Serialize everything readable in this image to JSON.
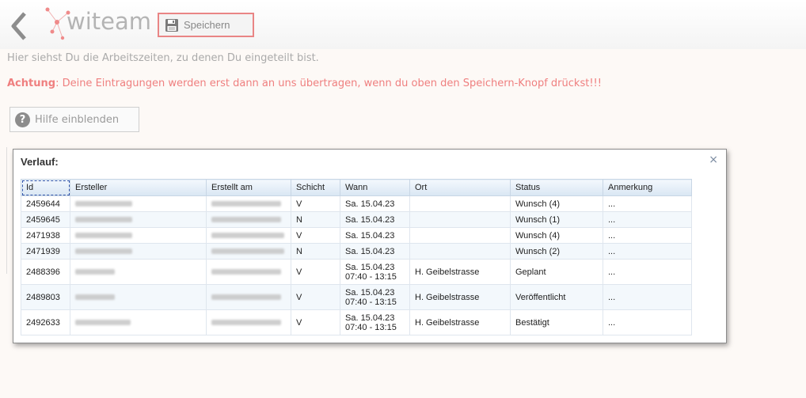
{
  "header": {
    "logo_text": "witeam",
    "save_label": "Speichern"
  },
  "info_text": "Hier siehst Du die Arbeitszeiten, zu denen Du eingeteilt bist.",
  "warning": {
    "prefix": "Achtung",
    "text": ": Deine Eintragungen werden erst dann an uns übertragen, wenn du oben den Speichern-Knopf drückst!!!"
  },
  "help_label": "Hilfe einblenden",
  "dialog": {
    "title": "Verlauf:",
    "close": "×",
    "columns": [
      "Id",
      "Ersteller",
      "Erstellt am",
      "Schicht",
      "Wann",
      "Ort",
      "Status",
      "Anmerkung"
    ],
    "rows": [
      {
        "id": "2459644",
        "schicht": "V",
        "wann1": "Sa. 15.04.23",
        "wann2": "",
        "ort": "",
        "status": "Wunsch (4)",
        "anmerkung": "..."
      },
      {
        "id": "2459645",
        "schicht": "N",
        "wann1": "Sa. 15.04.23",
        "wann2": "",
        "ort": "",
        "status": "Wunsch (1)",
        "anmerkung": "..."
      },
      {
        "id": "2471938",
        "schicht": "V",
        "wann1": "Sa. 15.04.23",
        "wann2": "",
        "ort": "",
        "status": "Wunsch (4)",
        "anmerkung": "..."
      },
      {
        "id": "2471939",
        "schicht": "N",
        "wann1": "Sa. 15.04.23",
        "wann2": "",
        "ort": "",
        "status": "Wunsch (2)",
        "anmerkung": "..."
      },
      {
        "id": "2488396",
        "schicht": "V",
        "wann1": "Sa. 15.04.23",
        "wann2": "07:40 - 13:15",
        "ort": "H. Geibelstrasse",
        "status": "Geplant",
        "anmerkung": "..."
      },
      {
        "id": "2489803",
        "schicht": "V",
        "wann1": "Sa. 15.04.23",
        "wann2": "07:40 - 13:15",
        "ort": "H. Geibelstrasse",
        "status": "Veröffentlicht",
        "anmerkung": "..."
      },
      {
        "id": "2492633",
        "schicht": "V",
        "wann1": "Sa. 15.04.23",
        "wann2": "07:40 - 13:15",
        "ort": "H. Geibelstrasse",
        "status": "Bestätigt",
        "anmerkung": "..."
      }
    ]
  },
  "colors": {
    "accent": "#e98585",
    "warning_text": "#ef7f7f",
    "muted_text": "#aaaaaa",
    "table_header": "#d9e6f3"
  }
}
